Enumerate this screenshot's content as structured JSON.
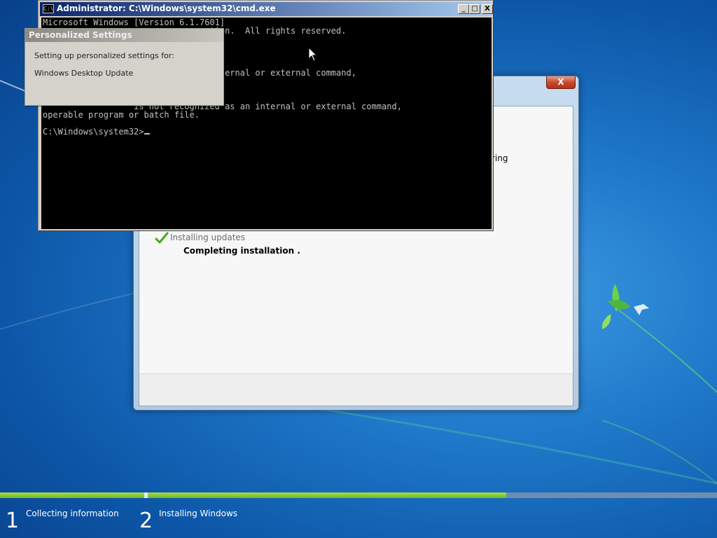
{
  "cmd": {
    "title": "Administrator: C:\\Windows\\system32\\cmd.exe",
    "icon_text": "C:\\",
    "minimize_label": "_",
    "maximize_label": "□",
    "close_label": "X",
    "lines": [
      "Microsoft Windows [Version 6.1.7601]",
      "                              oration.  All rights reserved.",
      "                              an internal or external command,",
      "                               OT",
      " '             '  is not recognized as an internal or external command,",
      "operable program or batch file.",
      "C:\\Windows\\system32>"
    ]
  },
  "personalized_settings": {
    "title": "Personalized Settings",
    "line1": "Setting up personalized settings for:",
    "line2": "Windows Desktop Update"
  },
  "setup": {
    "close_label": "X",
    "clipped_text": "ring",
    "steps": [
      {
        "label": "Installing updates",
        "status": "done"
      },
      {
        "label": "Completing installation .",
        "status": "current"
      }
    ]
  },
  "progress": {
    "stages": [
      {
        "number": "1",
        "label": "Collecting information"
      },
      {
        "number": "2",
        "label": "Installing Windows"
      }
    ],
    "stage1_fill": 1.0,
    "stage2_fill": 0.63
  },
  "colors": {
    "progress_green": "#8dcf3a",
    "desktop_blue": "#1f78c9"
  },
  "icons": [
    "cmd-icon",
    "check-icon",
    "mouse-pointer-icon",
    "close-icon"
  ]
}
